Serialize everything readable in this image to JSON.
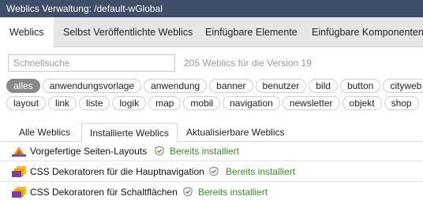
{
  "window": {
    "title": "Weblics Verwaltung: /default-wGlobal"
  },
  "main_tabs": [
    {
      "label": "Weblics",
      "active": true
    },
    {
      "label": "Selbst Veröffentlichte Weblics",
      "active": false
    },
    {
      "label": "Einfügbare Elemente",
      "active": false
    },
    {
      "label": "Einfügbare Komponenten",
      "active": false
    }
  ],
  "search": {
    "placeholder": "Schnellsuche",
    "value": "",
    "count_label": "205 Weblics für die Version 19"
  },
  "tags_row1": [
    "alles",
    "anwendungsvorlage",
    "anwendung",
    "banner",
    "benutzer",
    "bild",
    "button",
    "cityweb"
  ],
  "tags_row2": [
    "layout",
    "link",
    "liste",
    "logik",
    "map",
    "mobil",
    "navigation",
    "newsletter",
    "objekt",
    "shop"
  ],
  "active_tag": "alles",
  "sub_tabs": [
    {
      "label": "Alle Weblics",
      "active": false
    },
    {
      "label": "Installierte Weblics",
      "active": true
    },
    {
      "label": "Aktualisierbare Weblics",
      "active": false
    }
  ],
  "rows": [
    {
      "name": "Vorgefertige Seiten-Layouts",
      "status": "Bereits installiert",
      "icon": "layouts-icon"
    },
    {
      "name": "CSS Dekoratoren für die Hauptnavigation",
      "status": "Bereits installiert",
      "icon": "css-decorator-icon"
    },
    {
      "name": "CSS Dekoratoren für Schaltflächen",
      "status": "Bereits installiert",
      "icon": "css-decorator-icon"
    }
  ],
  "colors": {
    "titlebar": "#3f4f6a",
    "status_green": "#3d8a2a",
    "active_tag": "#8a8a8a"
  }
}
